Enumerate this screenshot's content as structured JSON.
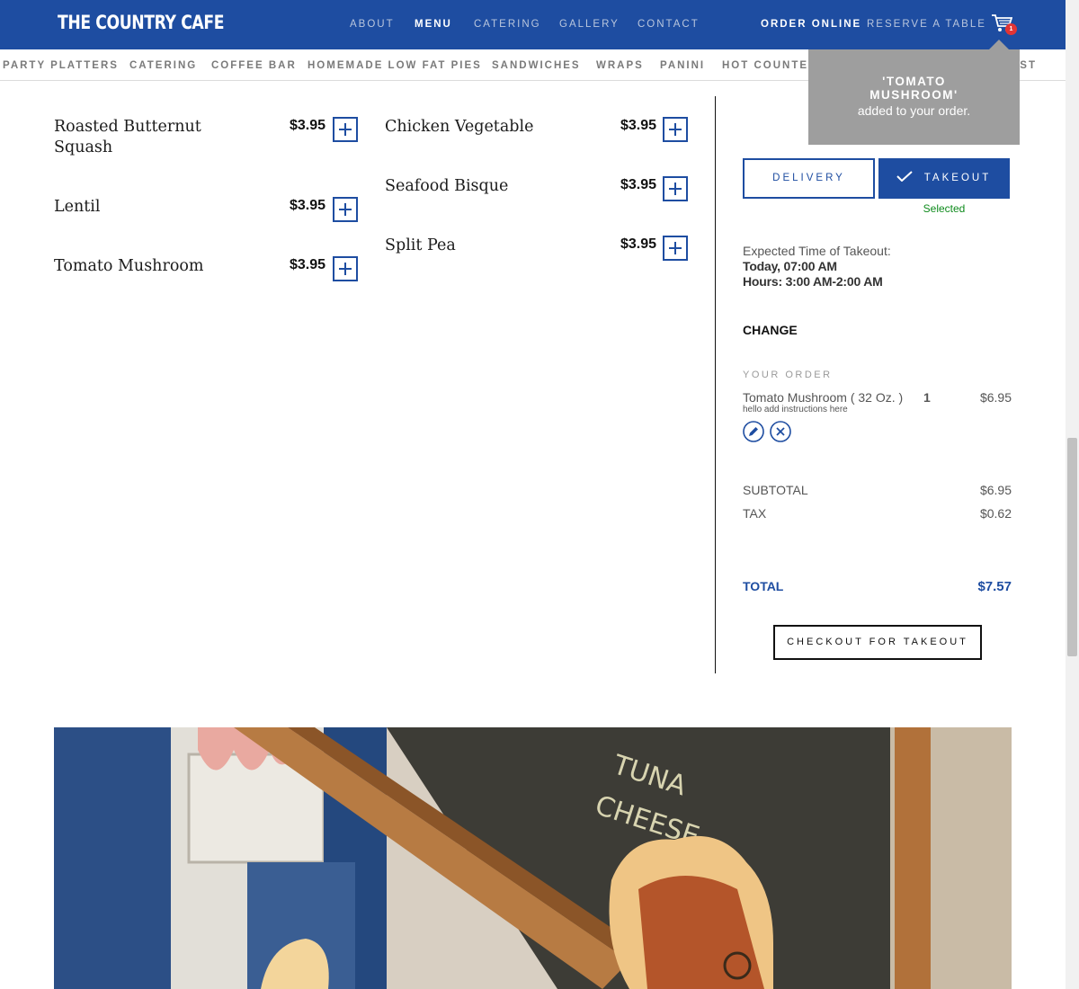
{
  "header": {
    "logo": "THE COUNTRY CAFE",
    "nav": [
      "ABOUT",
      "MENU",
      "CATERING",
      "GALLERY",
      "CONTACT"
    ],
    "active_nav": "MENU",
    "order_online": "ORDER ONLINE",
    "reserve": "RESERVE A TABLE",
    "cart_count": "1"
  },
  "subnav": [
    "PARTY PLATTERS",
    "CATERING",
    "COFFEE BAR",
    "HOMEMADE LOW FAT PIES",
    "SANDWICHES",
    "WRAPS",
    "PANINI",
    "HOT COUNTER",
    "AST"
  ],
  "menu": {
    "left": [
      {
        "name": "Roasted Butternut Squash",
        "price": "$3.95"
      },
      {
        "name": "Lentil",
        "price": "$3.95"
      },
      {
        "name": "Tomato Mushroom",
        "price": "$3.95"
      }
    ],
    "right": [
      {
        "name": "Chicken Vegetable",
        "price": "$3.95"
      },
      {
        "name": "Seafood Bisque",
        "price": "$3.95"
      },
      {
        "name": "Split Pea",
        "price": "$3.95"
      }
    ]
  },
  "toast": {
    "title": "'TOMATO MUSHROOM'",
    "message": "added to your order."
  },
  "order": {
    "delivery_label": "DELIVERY",
    "takeout_label": "TAKEOUT",
    "selected_label": "Selected",
    "expected_label": "Expected Time of Takeout:",
    "expected_time": "Today, 07:00 AM",
    "hours": "Hours: 3:00 AM-2:00 AM",
    "change_label": "CHANGE",
    "your_order_label": "YOUR ORDER",
    "line_item": {
      "name": "Tomato Mushroom ( 32 Oz. )",
      "note": "hello add instructions here",
      "qty": "1",
      "price": "$6.95"
    },
    "subtotal_label": "SUBTOTAL",
    "subtotal": "$6.95",
    "tax_label": "TAX",
    "tax": "$0.62",
    "total_label": "TOTAL",
    "total": "$7.57",
    "checkout_label": "CHECKOUT FOR TAKEOUT"
  },
  "colors": {
    "brand_blue": "#1e4da1",
    "selected_green": "#0d8a1b",
    "toast_gray": "#9e9e9e",
    "badge_red": "#e23434"
  }
}
